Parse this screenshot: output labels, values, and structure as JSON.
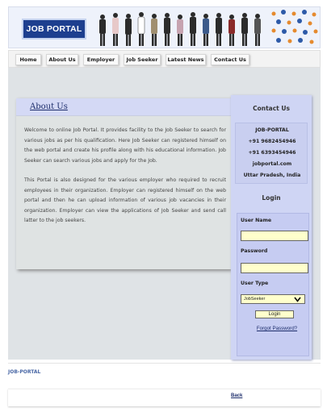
{
  "header": {
    "logo_text": "JOB PORTAL"
  },
  "nav": {
    "items": [
      "Home",
      "About Us",
      "Employer",
      "Job Seeker",
      "Latest News",
      "Contact Us"
    ]
  },
  "about": {
    "title": "About Us",
    "paragraph1": "Welcome to online Job Portal. It provides facility to the Job Seeker to search for various jobs as per his qualification. Here Job Seeker can registered himself on the web portal and create his profile along with his educational information. Job Seeker can search various jobs and apply for the Job.",
    "paragraph2": "This Portal is also designed for the various employer who required to recruit employees in their organization. Employer can registered himself on the web portal and then he can upload information of various job vacancies in their organization. Employer can view the applications of Job Seeker and send call latter to the job seekers."
  },
  "contact": {
    "heading": "Contact Us",
    "lines": [
      "JOB-PORTAL",
      "+91 9682454946",
      "+91 6393454946",
      "jobportal.com",
      "Uttar Pradesh, India"
    ]
  },
  "login": {
    "heading": "Login",
    "username_label": "User Name",
    "username_value": "",
    "password_label": "Password",
    "password_value": "",
    "usertype_label": "User Type",
    "usertype_value": "JobSeeker",
    "login_button": "Login",
    "forgot_link": "Forgot Password?"
  },
  "footer": {
    "brand": "JOB-PORTAL",
    "back_link": "Back"
  },
  "colors": {
    "logo_bg": "#1d3f8f",
    "sidebar_bg": "#cfd5f4",
    "input_bg": "#ffffcc",
    "link": "#1d2d6b"
  }
}
